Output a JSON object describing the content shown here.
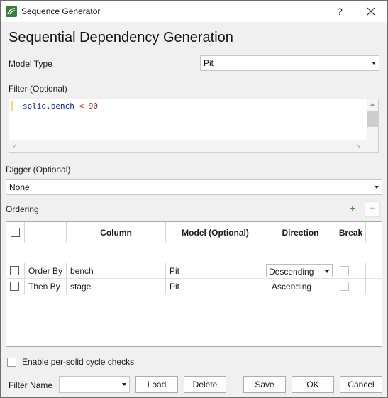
{
  "window": {
    "title": "Sequence Generator",
    "help_glyph": "?",
    "close_glyph": "✕"
  },
  "heading": "Sequential Dependency Generation",
  "model_type": {
    "label": "Model Type",
    "value": "Pit"
  },
  "filter": {
    "label": "Filter (Optional)",
    "code": {
      "ident": "solid",
      "dot": ".",
      "field": "bench",
      "op": "<",
      "num": "90"
    }
  },
  "digger": {
    "label": "Digger (Optional)",
    "value": "None"
  },
  "ordering": {
    "label": "Ordering",
    "add_glyph": "+",
    "remove_glyph": "−",
    "columns": [
      "",
      "",
      "Column",
      "Model (Optional)",
      "Direction",
      "Break"
    ],
    "rows": [
      {
        "order": "Order By",
        "column": "bench",
        "model": "Pit",
        "direction": "Descending"
      },
      {
        "order": "Then By",
        "column": "stage",
        "model": "Pit",
        "direction": "Ascending"
      }
    ]
  },
  "cycle_check": {
    "label": "Enable per-solid cycle checks",
    "checked": false
  },
  "footer": {
    "filter_name_label": "Filter Name",
    "filter_name_value": "",
    "load": "Load",
    "delete": "Delete",
    "save": "Save",
    "ok": "OK",
    "cancel": "Cancel"
  }
}
